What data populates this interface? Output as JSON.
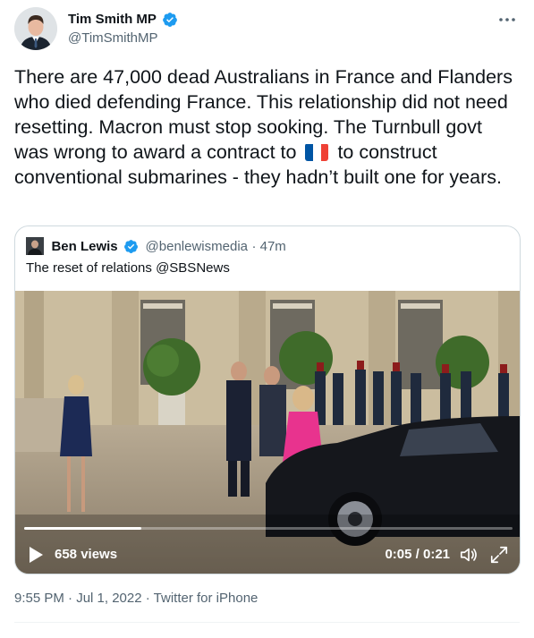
{
  "tweet": {
    "author_name": "Tim Smith MP",
    "author_handle": "@TimSmithMP",
    "more_icon": "ellipsis-icon",
    "text_before_flag": "There are 47,000 dead Australians in France and Flanders who died defending France. This relationship did not need resetting. Macron must stop sooking. The Turnbull govt was wrong to award a contract to",
    "flag_icon": "france-flag-emoji",
    "text_after_flag": "to construct conventional submarines - they hadn’t built one for years.",
    "timestamp": "9:55 PM · Jul 1, 2022",
    "separator": " · ",
    "source": "Twitter for iPhone"
  },
  "quoted_tweet": {
    "author_name": "Ben Lewis",
    "author_handle": "@benlewismedia",
    "age": "· 47m",
    "text": "The reset of relations @SBSNews",
    "video": {
      "views": "658 views",
      "time": "0:05 / 0:21",
      "progress": 0.24,
      "icons": [
        "play-icon",
        "volume-icon",
        "fullscreen-icon"
      ]
    }
  },
  "colors": {
    "verified_blue": "#1d9bf0",
    "text_primary": "#0f1419",
    "text_secondary": "#536471",
    "border": "#cfd9de"
  }
}
